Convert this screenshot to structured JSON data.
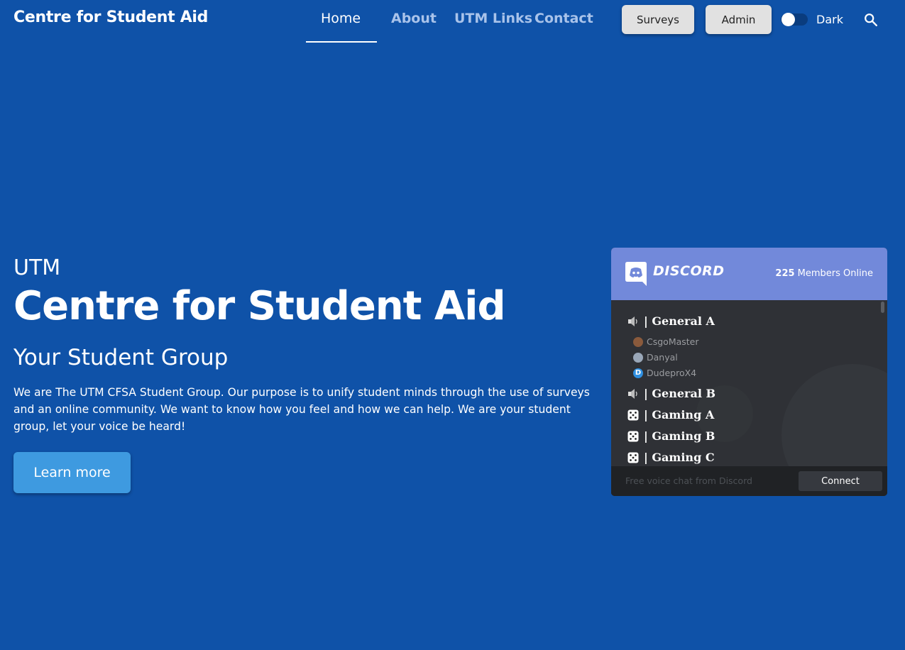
{
  "nav": {
    "brand": "Centre for Student Aid",
    "links": [
      {
        "label": "Home"
      },
      {
        "label": "About"
      },
      {
        "label": "UTM Links"
      },
      {
        "label": "Contact"
      }
    ],
    "surveys_label": "Surveys",
    "admin_label": "Admin",
    "theme_label": "Dark",
    "theme_on": false
  },
  "hero": {
    "small": "UTM",
    "title": "Centre for Student Aid",
    "subtitle": "Your Student Group",
    "text": "We are The UTM CFSA Student Group. Our purpose is to unify student minds through the use of surveys and an online community. We want to know how you feel and how we can help. We are your student group, let your voice be heard!",
    "button": "Learn more"
  },
  "widget": {
    "brand": "DISCORD",
    "members_count": "225",
    "members_label": " Members Online",
    "channels": [
      {
        "name": "| General A",
        "icon": "speaker-icon"
      },
      {
        "name": "| General B",
        "icon": "speaker-icon"
      },
      {
        "name": "| Gaming A",
        "icon": "dice-icon"
      },
      {
        "name": "| Gaming B",
        "icon": "dice-icon"
      },
      {
        "name": "| Gaming C",
        "icon": "dice-icon"
      }
    ],
    "members": [
      {
        "name": "CsgoMaster"
      },
      {
        "name": "Danyal"
      },
      {
        "name": "DudeproX4"
      }
    ],
    "footer_text": "Free voice chat from Discord",
    "connect_label": "Connect"
  },
  "colors": {
    "background": "#0f52a8",
    "discord_blurple": "#7289da",
    "learn_button": "#3e9ae0"
  }
}
